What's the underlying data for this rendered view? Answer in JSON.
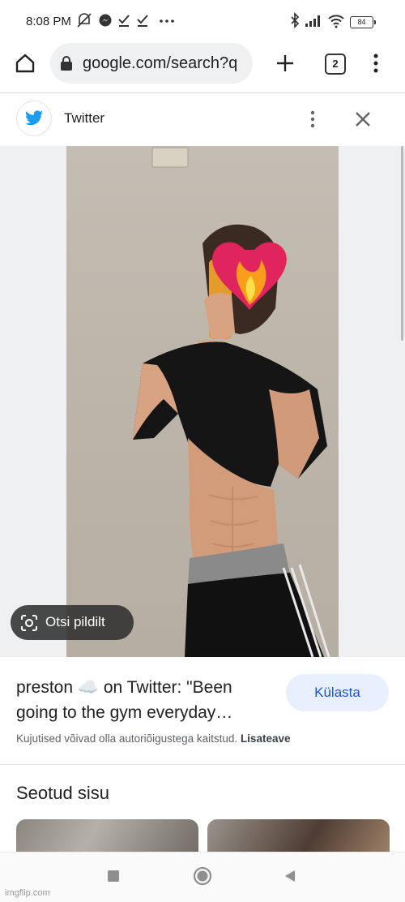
{
  "status_bar": {
    "time": "8:08 PM",
    "battery": "84",
    "icons": [
      "mute-icon",
      "messenger-icon",
      "check-icon",
      "check-icon",
      "more-dots-icon",
      "bluetooth-icon",
      "signal-icon",
      "wifi-icon",
      "battery-icon"
    ]
  },
  "browser": {
    "url": "google.com/search?q",
    "tab_count": "2",
    "icons": [
      "home-icon",
      "lock-icon",
      "plus-icon",
      "tabs-icon",
      "kebab-menu-icon"
    ]
  },
  "source": {
    "name": "Twitter",
    "icons": [
      "twitter-bird-icon",
      "kebab-menu-icon",
      "close-icon"
    ]
  },
  "viewer": {
    "lens_label": "Otsi pildilt",
    "icons": [
      "google-lens-icon"
    ]
  },
  "result": {
    "title": "preston ☁️ on Twitter: \"Been going to the gym everyday…",
    "visit_label": "Külasta",
    "copyright_text": "Kujutised võivad olla autoriõigustega kaitstud.",
    "learn_more": "Lisateave"
  },
  "related": {
    "heading": "Seotud sisu"
  },
  "navbar": {
    "icons": [
      "recents-square-icon",
      "home-circle-icon",
      "back-triangle-icon"
    ]
  },
  "watermark": "imgflip.com",
  "colors": {
    "accent_blue": "#1a57c4",
    "visit_button_bg": "#e8f0fe",
    "twitter_blue": "#1d9bf0",
    "lens_button_bg": "#303030"
  }
}
